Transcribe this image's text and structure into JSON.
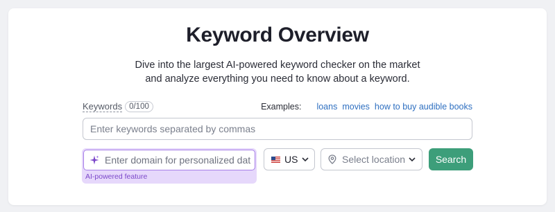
{
  "header": {
    "title": "Keyword Overview",
    "subtitle_line1": "Dive into the largest AI-powered keyword checker on the market",
    "subtitle_line2": "and analyze everything you need to know about a keyword."
  },
  "keywords": {
    "label": "Keywords",
    "count": "0/100",
    "placeholder": "Enter keywords separated by commas",
    "value": ""
  },
  "examples": {
    "label": "Examples:",
    "links": [
      "loans",
      "movies",
      "how to buy audible books"
    ]
  },
  "domain": {
    "placeholder": "Enter domain for personalized data",
    "value": "",
    "ai_note": "AI-powered feature",
    "icon": "sparkle-icon"
  },
  "country": {
    "value": "US",
    "icon": "us-flag-icon"
  },
  "location": {
    "placeholder": "Select location",
    "icon": "location-pin-icon"
  },
  "search_button": {
    "label": "Search"
  },
  "colors": {
    "accent_green": "#3d9e7a",
    "ai_purple": "#7b47c9",
    "ai_bg": "#e6d8fb",
    "link_blue": "#2e6fc0"
  }
}
